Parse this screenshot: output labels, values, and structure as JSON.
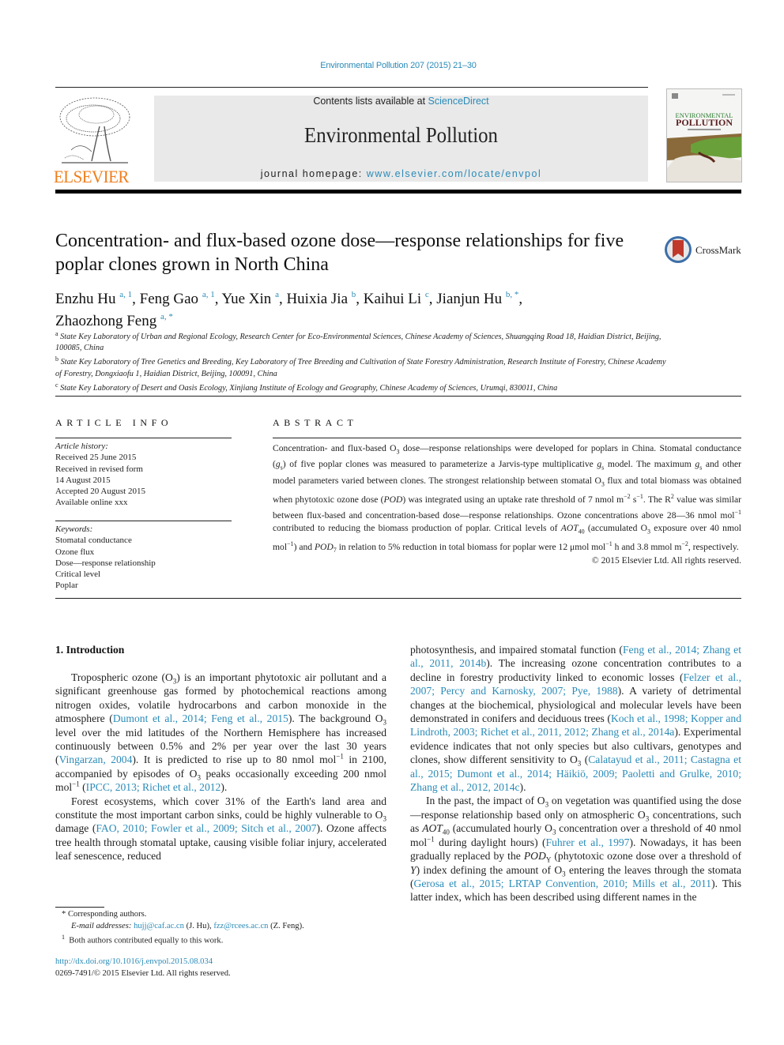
{
  "header": {
    "running_head": "Environmental Pollution 207 (2015) 21–30",
    "contents_prefix": "Contents lists available at ",
    "contents_link": "ScienceDirect",
    "journal_name": "Environmental Pollution",
    "homepage_prefix": "journal homepage: ",
    "homepage_link": "www.elsevier.com/locate/envpol",
    "publisher_logo_text": "ELSEVIER",
    "cover_title_line1": "ENVIRONMENTAL",
    "cover_title_line2": "POLLUTION",
    "brand_color": "#f07e1b",
    "link_color": "#2a8bb8"
  },
  "article": {
    "title": "Concentration- and flux-based ozone dose—response relationships for five poplar clones grown in North China",
    "crossmark_label": "CrossMark",
    "authors": [
      {
        "name": "Enzhu Hu",
        "sup": "a, 1",
        "sep": ", "
      },
      {
        "name": "Feng Gao",
        "sup": "a, 1",
        "sep": ", "
      },
      {
        "name": "Yue Xin",
        "sup": "a",
        "sep": ", "
      },
      {
        "name": "Huixia Jia",
        "sup": "b",
        "sep": ", "
      },
      {
        "name": "Kaihui Li",
        "sup": "c",
        "sep": ", "
      },
      {
        "name": "Jianjun Hu",
        "sup": "b, *",
        "sep": ","
      },
      {
        "name": "Zhaozhong Feng",
        "sup": "a, *",
        "sep": ""
      }
    ],
    "affiliations": [
      {
        "key": "a",
        "text": "State Key Laboratory of Urban and Regional Ecology, Research Center for Eco-Environmental Sciences, Chinese Academy of Sciences, Shuangqing Road 18, Haidian District, Beijing, 100085, China"
      },
      {
        "key": "b",
        "text": "State Key Laboratory of Tree Genetics and Breeding, Key Laboratory of Tree Breeding and Cultivation of State Forestry Administration, Research Institute of Forestry, Chinese Academy of Forestry, Dongxiaofu 1, Haidian District, Beijing, 100091, China"
      },
      {
        "key": "c",
        "text": "State Key Laboratory of Desert and Oasis Ecology, Xinjiang Institute of Ecology and Geography, Chinese Academy of Sciences, Urumqi, 830011, China"
      }
    ]
  },
  "article_info": {
    "heading": "ARTICLE INFO",
    "history_label": "Article history:",
    "history": [
      "Received 25 June 2015",
      "Received in revised form",
      "14 August 2015",
      "Accepted 20 August 2015",
      "Available online xxx"
    ],
    "keywords_label": "Keywords:",
    "keywords": [
      "Stomatal conductance",
      "Ozone flux",
      "Dose—response relationship",
      "Critical level",
      "Poplar"
    ]
  },
  "abstract": {
    "heading": "ABSTRACT",
    "segments": {
      "s1": "Concentration- and flux-based O",
      "s2": " dose—response relationships were developed for poplars in China. Stomatal conductance (",
      "s3": ") of five poplar clones was measured to parameterize a Jarvis-type multiplicative ",
      "s4": " model. The maximum ",
      "s5": " and other model parameters varied between clones. The strongest relationship between stomatal O",
      "s6": " flux and total biomass was obtained when phytotoxic ozone dose (",
      "s7": ") was integrated using an uptake rate threshold of 7 nmol m",
      "s8": " s",
      "s9": ". The R",
      "s10": " value was similar between flux-based and concentration-based dose—response relationships. Ozone concentrations above 28—36 nmol mol",
      "s11": " contributed to reducing the biomass production of poplar. Critical levels of ",
      "s12": " (accumulated O",
      "s13": " exposure over 40 nmol mol",
      "s14": ") and ",
      "s15": " in relation to 5% reduction in total biomass for poplar were 12 μmol mol",
      "s16": " h and 3.8 mmol m",
      "s17": ", respectively."
    },
    "copyright": "© 2015 Elsevier Ltd. All rights reserved."
  },
  "body": {
    "section_heading": "1.  Introduction",
    "col1": {
      "p1a": "Tropospheric ozone (O",
      "p1b": ") is an important phytotoxic air pollutant and a significant greenhouse gas formed by photochemical reactions among nitrogen oxides, volatile hydrocarbons and carbon monoxide in the atmosphere (",
      "p1c_ref": "Dumont et al., 2014; Feng et al., 2015",
      "p1d": "). The background O",
      "p1e": " level over the mid latitudes of the Northern Hemisphere has increased continuously between 0.5% and 2% per year over the last 30 years (",
      "p1f_ref": "Vingarzan, 2004",
      "p1g": "). It is predicted to rise up to 80 nmol mol",
      "p1h": " in 2100, accompanied by episodes of O",
      "p1i": " peaks occasionally exceeding 200 nmol mol",
      "p1j": " (",
      "p1k_ref": "IPCC, 2013; Richet et al., 2012",
      "p1l": ").",
      "p2a": "Forest ecosystems, which cover 31% of the Earth's land area and constitute the most important carbon sinks, could be highly vulnerable to O",
      "p2b": " damage (",
      "p2c_ref": "FAO, 2010; Fowler et al., 2009; Sitch et al., 2007",
      "p2d": "). Ozone affects tree health through stomatal uptake, causing visible foliar injury, accelerated leaf senescence, reduced"
    },
    "col2": {
      "c1a": "photosynthesis, and impaired stomatal function (",
      "c1b_ref": "Feng et al., 2014; Zhang et al., 2011, 2014b",
      "c1c": "). The increasing ozone concentration contributes to a decline in forestry productivity linked to economic losses (",
      "c1d_ref": "Felzer et al., 2007; Percy and Karnosky, 2007; Pye, 1988",
      "c1e": "). A variety of detrimental changes at the biochemical, physiological and molecular levels have been demonstrated in conifers and deciduous trees (",
      "c1f_ref": "Koch et al., 1998; Kopper and Lindroth, 2003; Richet et al., 2011, 2012; Zhang et al., 2014a",
      "c1g": "). Experimental evidence indicates that not only species but also cultivars, genotypes and clones, show different sensitivity to O",
      "c1h": " (",
      "c1i_ref": "Calatayud et al., 2011; Castagna et al., 2015; Dumont et al., 2014; Häikiö, 2009; Paoletti and Grulke, 2010; Zhang et al., 2012, 2014c",
      "c1j": ").",
      "p3a": "In the past, the impact of O",
      "p3b": " on vegetation was quantified using the dose—response relationship based only on atmospheric O",
      "p3c": " concentrations, such as ",
      "p3d": " (accumulated hourly O",
      "p3e": " concentration over a threshold of 40 nmol mol",
      "p3f": " during daylight hours) (",
      "p3g_ref": "Fuhrer et al., 1997",
      "p3h": "). Nowadays, it has been gradually replaced by the ",
      "p3i": " (phytotoxic ozone dose over a threshold of ",
      "p3j": ") index defining the amount of O",
      "p3k": " entering the leaves through the stomata (",
      "p3l_ref": "Gerosa et al., 2015; LRTAP Convention, 2010; Mills et al., 2011",
      "p3m": "). This latter index, which has been described using different names in the"
    }
  },
  "footnotes": {
    "corresponding": "Corresponding authors.",
    "email_label": "E-mail addresses:",
    "email1": "hujj@caf.ac.cn",
    "email1_who": " (J. Hu), ",
    "email2": "fzz@rcees.ac.cn",
    "email2_who": " (Z. Feng).",
    "equal": "Both authors contributed equally to this work.",
    "doi": "http://dx.doi.org/10.1016/j.envpol.2015.08.034",
    "issn": "0269-7491/© 2015 Elsevier Ltd. All rights reserved."
  }
}
